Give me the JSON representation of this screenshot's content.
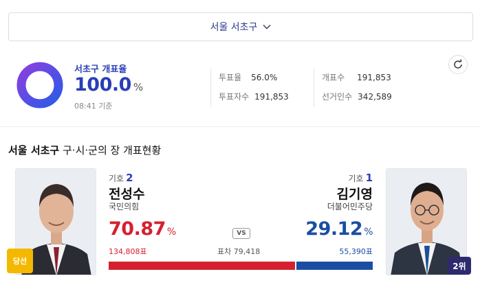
{
  "region": {
    "label": "서울 서초구"
  },
  "summary": {
    "title": "서초구 개표율",
    "percent": "100.0",
    "percent_unit": "%",
    "time": "08:41 기준",
    "turnout_label": "투표율",
    "turnout_value": "56.0%",
    "voters_label": "투표자수",
    "voters_value": "191,853",
    "counted_label": "개표수",
    "counted_value": "191,853",
    "electorate_label": "선거인수",
    "electorate_value": "342,589"
  },
  "section": {
    "title_bold": "서울 서초구",
    "title_rest": " 구·시·군의 장 개표현황"
  },
  "candidates": [
    {
      "num_label": "기호",
      "num": "2",
      "name": "전성수",
      "party": "국민의힘",
      "percent": "70.87",
      "percent_unit": "%",
      "votes": "134,808표",
      "badge": "당선",
      "share": 70.87,
      "color": "#d6202f"
    },
    {
      "num_label": "기호",
      "num": "1",
      "name": "김기영",
      "party": "더불어민주당",
      "percent": "29.12",
      "percent_unit": "%",
      "votes": "55,390표",
      "badge": "2위",
      "share": 29.12,
      "color": "#1b4ea3"
    }
  ],
  "vs_label": "VS",
  "diff_label": "표차",
  "diff_value": "79,418",
  "colors": {
    "accent": "#2a3eb5",
    "donut_start": "#7b3fe4",
    "donut_end": "#2a5be8"
  },
  "icons": {
    "dropdown": "chevron-down-icon",
    "refresh": "refresh-icon"
  }
}
